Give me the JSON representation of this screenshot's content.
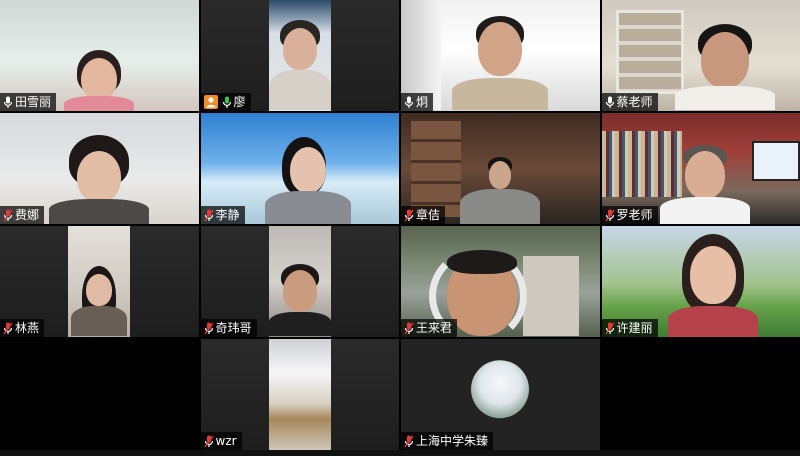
{
  "participants": [
    {
      "name": "田雪丽",
      "mic": "on",
      "video": "on"
    },
    {
      "name": "廖",
      "mic": "on",
      "video": "on",
      "host_icon": true
    },
    {
      "name": "炯",
      "mic": "on",
      "video": "on"
    },
    {
      "name": "蔡老师",
      "mic": "on",
      "video": "on"
    },
    {
      "name": "费娜",
      "mic": "muted",
      "video": "on"
    },
    {
      "name": "李静",
      "mic": "muted",
      "video": "on"
    },
    {
      "name": "章佶",
      "mic": "muted",
      "video": "on"
    },
    {
      "name": "罗老师",
      "mic": "muted",
      "video": "on"
    },
    {
      "name": "林燕",
      "mic": "muted",
      "video": "on"
    },
    {
      "name": "奇玮哥",
      "mic": "muted",
      "video": "on"
    },
    {
      "name": "王来君",
      "mic": "muted",
      "video": "on"
    },
    {
      "name": "许建丽",
      "mic": "muted",
      "video": "on"
    },
    {
      "name": "wzr",
      "mic": "muted",
      "video": "on"
    },
    {
      "name": "上海中学朱臻",
      "mic": "muted",
      "video": "off"
    }
  ],
  "colors": {
    "mic_on": "#ffffff",
    "mic_muted": "#e03b3b",
    "host_badge": "#f28c28",
    "nameplate_bg": "#000000b8"
  },
  "icons": {
    "mic_on": "microphone-icon",
    "mic_muted": "microphone-muted-icon",
    "host": "person-icon"
  }
}
